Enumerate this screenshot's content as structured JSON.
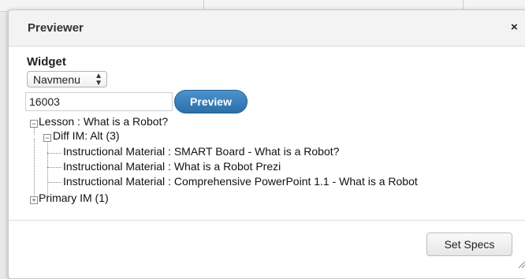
{
  "dialog": {
    "title": "Previewer",
    "close_glyph": "×"
  },
  "form": {
    "widget_label": "Widget",
    "widget_select_value": "Navmenu",
    "id_value": "16003",
    "preview_label": "Preview"
  },
  "tree": {
    "root": "Lesson : What is a Robot?",
    "group1": "Diff IM: Alt (3)",
    "items": [
      "Instructional Material : SMART Board - What is a Robot?",
      "Instructional Material : What is a Robot Prezi",
      "Instructional Material : Comprehensive PowerPoint 1.1 - What is a Robot"
    ],
    "group2": "Primary IM (1)",
    "collapse_glyph": "−",
    "expand_glyph": "+"
  },
  "footer": {
    "set_specs_label": "Set Specs"
  },
  "icons": {
    "close": "close-icon",
    "select_arrows": "updown-arrows-icon",
    "tree_toggle": "tree-toggle-icon",
    "resize": "resize-grip-icon"
  }
}
